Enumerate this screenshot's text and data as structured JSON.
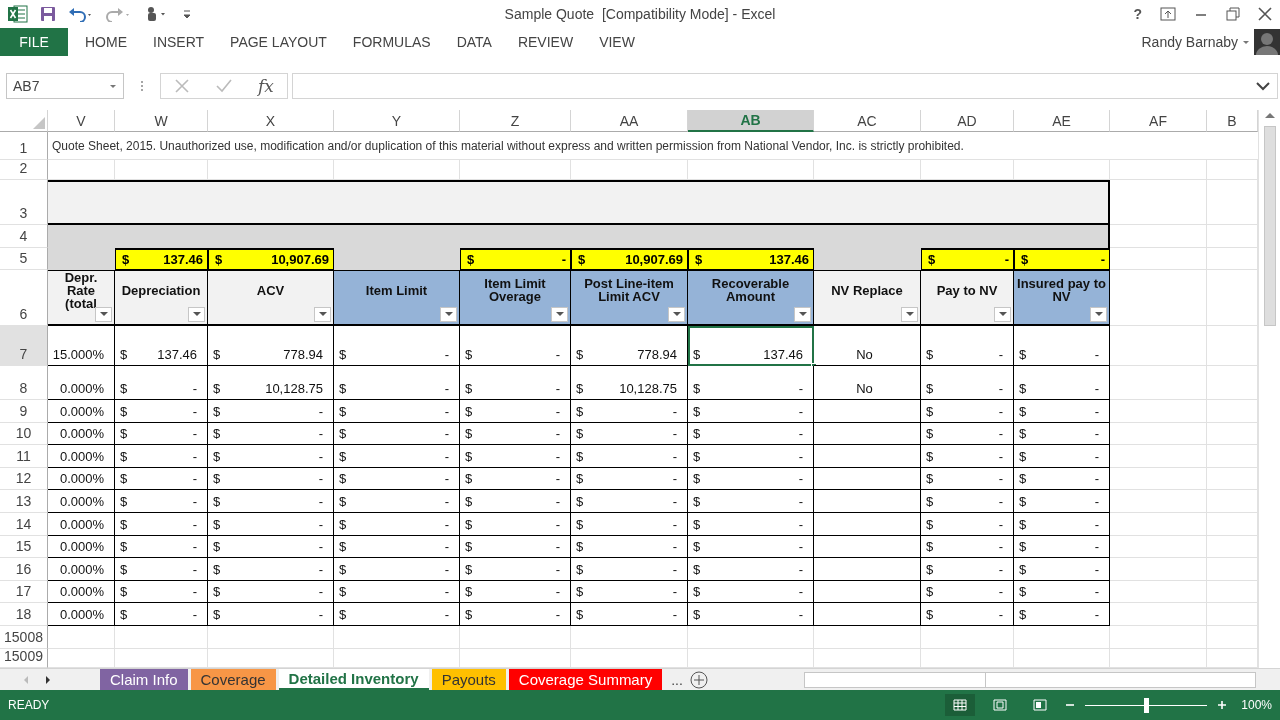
{
  "title_bar": {
    "title": "Sample Quote  [Compatibility Mode] - Excel",
    "help": "?"
  },
  "ribbon": {
    "tabs": [
      {
        "label": "FILE",
        "kind": "file"
      },
      {
        "label": "HOME",
        "kind": "tab"
      },
      {
        "label": "INSERT",
        "kind": "tab"
      },
      {
        "label": "PAGE LAYOUT",
        "kind": "tab"
      },
      {
        "label": "FORMULAS",
        "kind": "tab"
      },
      {
        "label": "DATA",
        "kind": "tab"
      },
      {
        "label": "REVIEW",
        "kind": "tab"
      },
      {
        "label": "VIEW",
        "kind": "tab"
      }
    ],
    "user": "Randy Barnaby"
  },
  "formula_bar": {
    "name_box": "AB7",
    "function_label": "fx"
  },
  "sheet": {
    "columns": [
      {
        "letter": "V",
        "selected": false
      },
      {
        "letter": "W",
        "selected": false
      },
      {
        "letter": "X",
        "selected": false
      },
      {
        "letter": "Y",
        "selected": false
      },
      {
        "letter": "Z",
        "selected": false
      },
      {
        "letter": "AA",
        "selected": false
      },
      {
        "letter": "AB",
        "selected": true
      },
      {
        "letter": "AC",
        "selected": false
      },
      {
        "letter": "AD",
        "selected": false
      },
      {
        "letter": "AE",
        "selected": false
      },
      {
        "letter": "AF",
        "selected": false
      },
      {
        "letter": "B",
        "selected": false
      }
    ],
    "top_row_numbers": [
      "1",
      "2",
      "3",
      "4",
      "5",
      "6"
    ],
    "notice": "Quote Sheet, 2015.  Unauthorized use, modification and/or duplication of this material without express and written permission from National Vendor, Inc. is strictly prohibited.",
    "totals": [
      {
        "kind": "blank"
      },
      [
        "$",
        "137.46"
      ],
      [
        "$",
        "10,907.69"
      ],
      {
        "kind": "blank"
      },
      [
        "$",
        "-"
      ],
      [
        "$",
        "10,907.69"
      ],
      [
        "$",
        "137.46"
      ],
      {
        "kind": "blank"
      },
      [
        "$",
        "-"
      ],
      [
        "$",
        "-"
      ]
    ],
    "headers": [
      {
        "label": "Depr. Rate (total",
        "color": "#f2f2f2"
      },
      {
        "label": "Depreciation",
        "color": "#f2f2f2"
      },
      {
        "label": "ACV",
        "color": "#f2f2f2"
      },
      {
        "label": "Item Limit",
        "color": "#95b3d7"
      },
      {
        "label": "Item Limit Overage",
        "color": "#95b3d7"
      },
      {
        "label": "Post Line-item Limit ACV",
        "color": "#95b3d7"
      },
      {
        "label": "Recoverable Amount",
        "color": "#95b3d7"
      },
      {
        "label": "NV Replace",
        "color": "#f2f2f2"
      },
      {
        "label": "Pay to NV",
        "color": "#f2f2f2"
      },
      {
        "label": "Insured pay to NV",
        "color": "#95b3d7"
      }
    ],
    "rows": [
      {
        "number": "7",
        "selected": true,
        "cells": [
          "15.000%",
          [
            "$",
            "137.46"
          ],
          [
            "$",
            "778.94"
          ],
          [
            "$",
            "-"
          ],
          [
            "$",
            "-"
          ],
          [
            "$",
            "778.94"
          ],
          [
            "$",
            "137.46"
          ],
          "No",
          [
            "$",
            "-"
          ],
          [
            "$",
            "-"
          ]
        ]
      },
      {
        "number": "8",
        "selected": false,
        "cells": [
          "0.000%",
          [
            "$",
            "-"
          ],
          [
            "$",
            "10,128.75"
          ],
          [
            "$",
            "-"
          ],
          [
            "$",
            "-"
          ],
          [
            "$",
            "10,128.75"
          ],
          [
            "$",
            "-"
          ],
          "No",
          [
            "$",
            "-"
          ],
          [
            "$",
            "-"
          ]
        ]
      },
      {
        "number": "9",
        "selected": false,
        "cells": [
          "0.000%",
          [
            "$",
            "-"
          ],
          [
            "$",
            "-"
          ],
          [
            "$",
            "-"
          ],
          [
            "$",
            "-"
          ],
          [
            "$",
            "-"
          ],
          [
            "$",
            "-"
          ],
          null,
          [
            "$",
            "-"
          ],
          [
            "$",
            "-"
          ]
        ]
      },
      {
        "number": "10",
        "selected": false,
        "cells": [
          "0.000%",
          [
            "$",
            "-"
          ],
          [
            "$",
            "-"
          ],
          [
            "$",
            "-"
          ],
          [
            "$",
            "-"
          ],
          [
            "$",
            "-"
          ],
          [
            "$",
            "-"
          ],
          null,
          [
            "$",
            "-"
          ],
          [
            "$",
            "-"
          ]
        ]
      },
      {
        "number": "11",
        "selected": false,
        "cells": [
          "0.000%",
          [
            "$",
            "-"
          ],
          [
            "$",
            "-"
          ],
          [
            "$",
            "-"
          ],
          [
            "$",
            "-"
          ],
          [
            "$",
            "-"
          ],
          [
            "$",
            "-"
          ],
          null,
          [
            "$",
            "-"
          ],
          [
            "$",
            "-"
          ]
        ]
      },
      {
        "number": "12",
        "selected": false,
        "cells": [
          "0.000%",
          [
            "$",
            "-"
          ],
          [
            "$",
            "-"
          ],
          [
            "$",
            "-"
          ],
          [
            "$",
            "-"
          ],
          [
            "$",
            "-"
          ],
          [
            "$",
            "-"
          ],
          null,
          [
            "$",
            "-"
          ],
          [
            "$",
            "-"
          ]
        ]
      },
      {
        "number": "13",
        "selected": false,
        "cells": [
          "0.000%",
          [
            "$",
            "-"
          ],
          [
            "$",
            "-"
          ],
          [
            "$",
            "-"
          ],
          [
            "$",
            "-"
          ],
          [
            "$",
            "-"
          ],
          [
            "$",
            "-"
          ],
          null,
          [
            "$",
            "-"
          ],
          [
            "$",
            "-"
          ]
        ]
      },
      {
        "number": "14",
        "selected": false,
        "cells": [
          "0.000%",
          [
            "$",
            "-"
          ],
          [
            "$",
            "-"
          ],
          [
            "$",
            "-"
          ],
          [
            "$",
            "-"
          ],
          [
            "$",
            "-"
          ],
          [
            "$",
            "-"
          ],
          null,
          [
            "$",
            "-"
          ],
          [
            "$",
            "-"
          ]
        ]
      },
      {
        "number": "15",
        "selected": false,
        "cells": [
          "0.000%",
          [
            "$",
            "-"
          ],
          [
            "$",
            "-"
          ],
          [
            "$",
            "-"
          ],
          [
            "$",
            "-"
          ],
          [
            "$",
            "-"
          ],
          [
            "$",
            "-"
          ],
          null,
          [
            "$",
            "-"
          ],
          [
            "$",
            "-"
          ]
        ]
      },
      {
        "number": "16",
        "selected": false,
        "cells": [
          "0.000%",
          [
            "$",
            "-"
          ],
          [
            "$",
            "-"
          ],
          [
            "$",
            "-"
          ],
          [
            "$",
            "-"
          ],
          [
            "$",
            "-"
          ],
          [
            "$",
            "-"
          ],
          null,
          [
            "$",
            "-"
          ],
          [
            "$",
            "-"
          ]
        ]
      },
      {
        "number": "17",
        "selected": false,
        "cells": [
          "0.000%",
          [
            "$",
            "-"
          ],
          [
            "$",
            "-"
          ],
          [
            "$",
            "-"
          ],
          [
            "$",
            "-"
          ],
          [
            "$",
            "-"
          ],
          [
            "$",
            "-"
          ],
          null,
          [
            "$",
            "-"
          ],
          [
            "$",
            "-"
          ]
        ]
      },
      {
        "number": "18",
        "selected": false,
        "cells": [
          "0.000%",
          [
            "$",
            "-"
          ],
          [
            "$",
            "-"
          ],
          [
            "$",
            "-"
          ],
          [
            "$",
            "-"
          ],
          [
            "$",
            "-"
          ],
          [
            "$",
            "-"
          ],
          null,
          [
            "$",
            "-"
          ],
          [
            "$",
            "-"
          ]
        ]
      }
    ],
    "trailing_row_numbers": [
      "15008",
      "15009"
    ]
  },
  "sheet_tabs": {
    "tabs": [
      {
        "label": "Claim Info",
        "color": "#8064a2",
        "selected": false
      },
      {
        "label": "Coverage",
        "color": "#f79646",
        "selected": false
      },
      {
        "label": "Detailed Inventory",
        "color": "#217346",
        "selected": true
      },
      {
        "label": "Payouts",
        "color": "#ffc000",
        "selected": false
      },
      {
        "label": "Coverage Summary",
        "color": "#ff0000",
        "selected": false
      }
    ],
    "more": "..."
  },
  "status_bar": {
    "status": "READY",
    "zoom": {
      "level": 0.5,
      "label": "100%"
    }
  }
}
